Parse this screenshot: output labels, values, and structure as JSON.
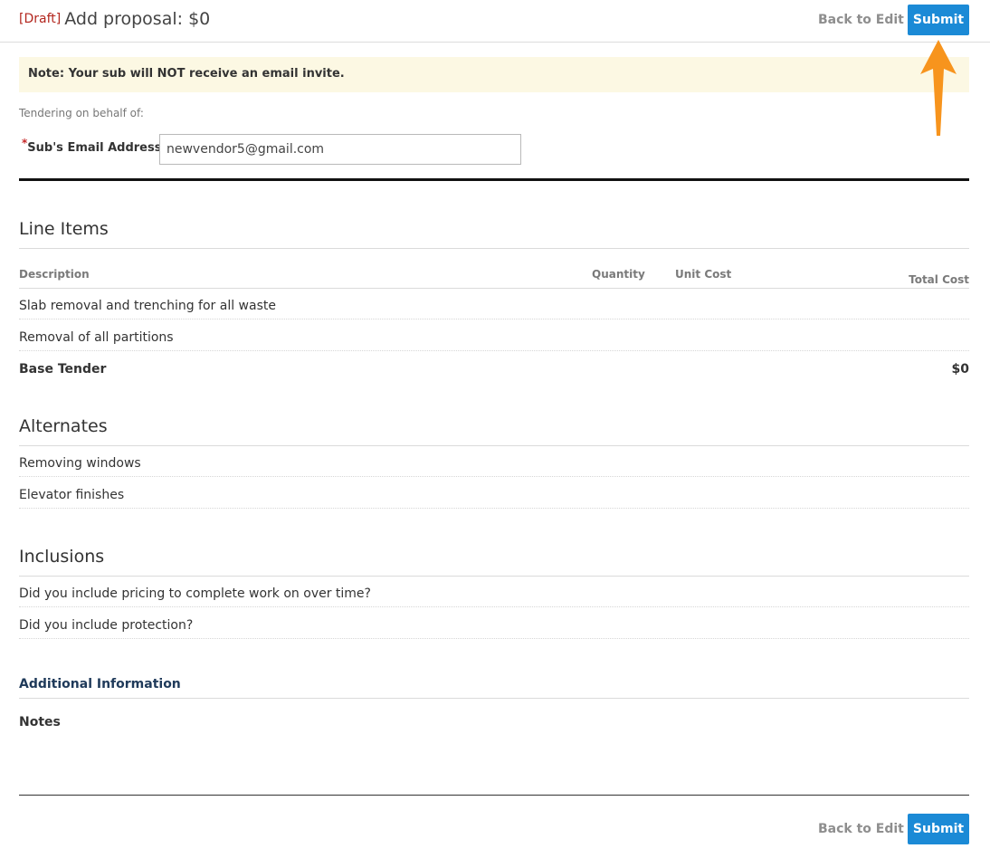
{
  "header": {
    "draft_label": "[Draft]",
    "title": "Add proposal: $0",
    "back_to_edit": "Back to Edit",
    "submit": "Submit"
  },
  "note": "Note: Your sub will NOT receive an email invite.",
  "tendering_label": "Tendering on behalf of:",
  "email_field": {
    "required_mark": "*",
    "label": "Sub's Email Address",
    "value": "newvendor5@gmail.com"
  },
  "line_items": {
    "title": "Line Items",
    "columns": {
      "description": "Description",
      "quantity": "Quantity",
      "unit_cost": "Unit Cost",
      "total_cost": "Total Cost"
    },
    "rows": [
      "Slab removal and trenching for all waste",
      "Removal of all partitions"
    ],
    "base_tender_label": "Base Tender",
    "base_tender_value": "$0"
  },
  "alternates": {
    "title": "Alternates",
    "rows": [
      "Removing windows",
      "Elevator finishes"
    ]
  },
  "inclusions": {
    "title": "Inclusions",
    "rows": [
      "Did you include pricing to complete work on over time?",
      "Did you include protection?"
    ]
  },
  "additional_info": {
    "title": "Additional Information",
    "notes_label": "Notes"
  },
  "footer": {
    "back_to_edit": "Back to Edit",
    "submit": "Submit"
  },
  "colors": {
    "accent": "#1b8ad6",
    "annotation_arrow": "#f7941d",
    "note_background": "#fcf8e3"
  }
}
